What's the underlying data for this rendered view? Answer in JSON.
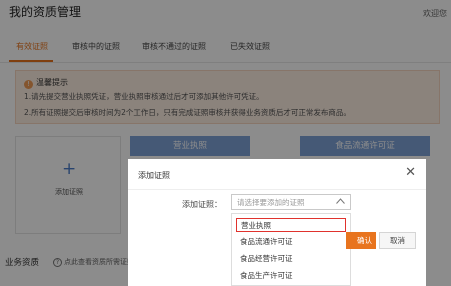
{
  "header": {
    "title": "我的资质管理",
    "welcome": "欢迎您"
  },
  "tabs": [
    {
      "label": "有效证照",
      "active": true
    },
    {
      "label": "审核中的证照",
      "active": false
    },
    {
      "label": "审核不通过的证照",
      "active": false
    },
    {
      "label": "已失效证照",
      "active": false
    }
  ],
  "notice": {
    "icon": "warning-icon",
    "title": "温馨提示",
    "lines": [
      "1.请先提交营业执照凭证，营业执照审核通过后才可添加其他许可凭证。",
      "2.所有证照提交后审核时间为2个工作日，只有完成证照审核并获得业务资质后才可正常发布商品。"
    ]
  },
  "cards": {
    "add_label": "添加证照",
    "license_cards": [
      "营业执照",
      "食品流通许可证"
    ]
  },
  "bottom": {
    "section_title": "业务资质",
    "hint": "点此查看资质所需证照"
  },
  "modal": {
    "title": "添加证照",
    "field_label": "添加证照：",
    "select_placeholder": "请选择要添加的证照",
    "options": [
      "营业执照",
      "食品流通许可证",
      "食品经营许可证",
      "食品生产许可证"
    ],
    "selected_option": "营业执照",
    "confirm_label": "确认",
    "cancel_label": "取消"
  },
  "colors": {
    "accent": "#e8741e",
    "card_blue": "#7ea2d8",
    "notice_bg": "#fdeee2",
    "highlight_border": "#e0322d"
  }
}
